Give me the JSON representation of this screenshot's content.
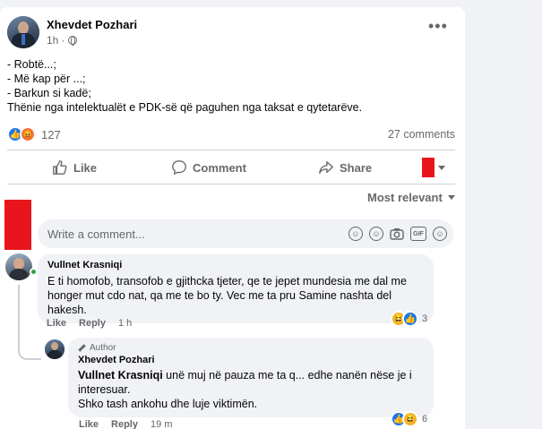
{
  "post": {
    "author": "Xhevdet Pozhari",
    "time": "1h ·",
    "privacy_icon": "globe-icon",
    "more_label": "•••",
    "body_lines": [
      "- Robtë...;",
      "- Më kap për ...;",
      "- Barkun si kadë;",
      "Thënie nga intelektualët e PDK-së që paguhen nga taksat e qytetarëve."
    ],
    "reaction_icons": [
      "like-reaction-icon",
      "angry-reaction-icon"
    ],
    "reaction_count": "127",
    "comments_count": "27 comments"
  },
  "actions": {
    "like": "Like",
    "comment": "Comment",
    "share": "Share"
  },
  "sort": {
    "label": "Most relevant"
  },
  "composer": {
    "placeholder": "Write a comment...",
    "icons": [
      "avatar-sticker-icon",
      "emoji-icon",
      "camera-icon",
      "gif-icon",
      "sticker-icon"
    ],
    "gif_text": "GIF"
  },
  "comments": [
    {
      "author": "Vullnet Krasniqi",
      "text_lines": [
        "E ti homofob, transofob e gjithcka tjeter, qe te jepet mundesia me dal me",
        "honger mut cdo nat, qa me te bo ty. Vec me ta pru Samine nashta del",
        "hakesh."
      ],
      "like": "Like",
      "reply": "Reply",
      "time": "1 h",
      "reaction_count": "3"
    },
    {
      "badge": "Author",
      "author": "Xhevdet Pozhari",
      "mention": "Vullnet Krasniqi",
      "text_line1": " unë muj në pauza me ta q... edhe nanën nëse je i",
      "text_line2": "interesuar.",
      "text_line3": "Shko tash ankohu dhe luje viktimën.",
      "like": "Like",
      "reply": "Reply",
      "time": "19 m",
      "reaction_count": "6"
    }
  ],
  "colors": {
    "accent": "#1877f2",
    "redaction": "#e8161c",
    "online": "#31a24c"
  }
}
